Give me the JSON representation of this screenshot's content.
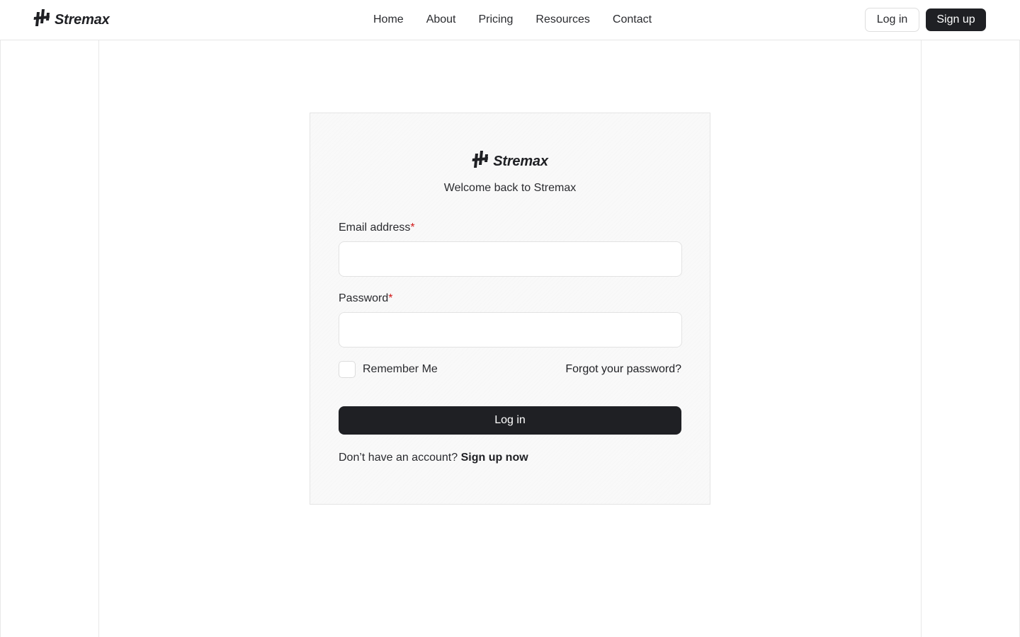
{
  "brand": {
    "name": "Stremax",
    "logo_icon": "stremax-logo-icon"
  },
  "nav": {
    "items": [
      {
        "label": "Home"
      },
      {
        "label": "About"
      },
      {
        "label": "Pricing"
      },
      {
        "label": "Resources"
      },
      {
        "label": "Contact"
      }
    ],
    "login_label": "Log in",
    "signup_label": "Sign up"
  },
  "card": {
    "brand_name": "Stremax",
    "welcome": "Welcome back to Stremax",
    "email": {
      "label": "Email address",
      "required_mark": "*",
      "value": "",
      "placeholder": ""
    },
    "password": {
      "label": "Password",
      "required_mark": "*",
      "value": "",
      "placeholder": ""
    },
    "remember_label": "Remember Me",
    "remember_checked": false,
    "forgot_label": "Forgot your password?",
    "submit_label": "Log in",
    "no_account_text": "Don’t have an account?",
    "signup_link_label": "Sign up now"
  },
  "colors": {
    "primary_dark": "#1f2024",
    "required": "#d11a1a",
    "card_bg": "#f9f9f9",
    "border": "#e4e4e4"
  }
}
